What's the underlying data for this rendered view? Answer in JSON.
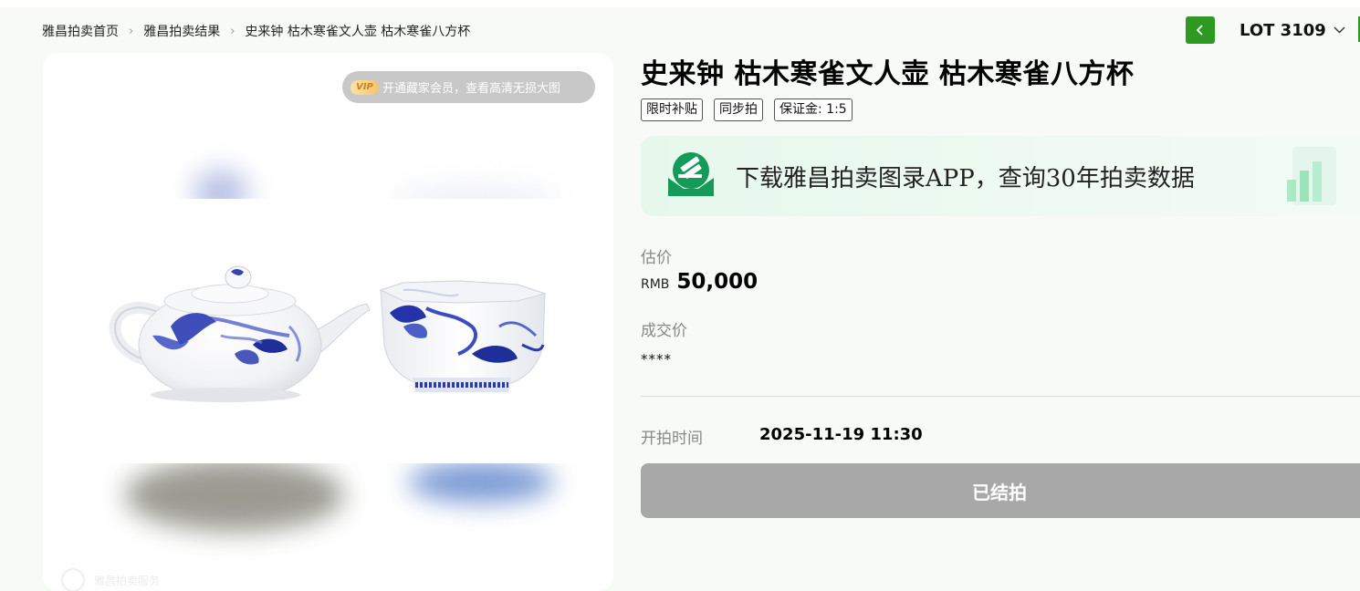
{
  "breadcrumb": {
    "home": "雅昌拍卖首页",
    "results": "雅昌拍卖结果",
    "current": "史来钟 枯木寒雀文人壶 枯木寒雀八方杯"
  },
  "lot_nav": {
    "lot_label": "LOT 3109",
    "prev_icon": "chevron-left-icon",
    "dropdown_icon": "chevron-down-icon"
  },
  "image_panel": {
    "vip_badge": "VIP",
    "vip_text": "开通藏家会员，查看高清无损大图",
    "watermark": "雅昌拍卖服务"
  },
  "lot": {
    "title": "史来钟 枯木寒雀文人壶 枯木寒雀八方杯",
    "tags": [
      "限时补贴",
      "同步拍",
      "保证金: 1:5"
    ]
  },
  "app_banner": {
    "text": "下载雅昌拍卖图录APP，查询30年拍卖数据"
  },
  "estimate": {
    "label": "估价",
    "currency": "RMB",
    "value": "50,000"
  },
  "hammer_price": {
    "label": "成交价",
    "value": "****"
  },
  "start_time": {
    "label": "开拍时间",
    "value": "2025-11-19 11:30"
  },
  "status_button": {
    "label": "已结拍"
  },
  "colors": {
    "accent_green": "#2e9a22",
    "page_bg": "#f7faf7",
    "disabled_button": "#a8a8a8",
    "porcelain_blue": "#2a3bb0"
  }
}
